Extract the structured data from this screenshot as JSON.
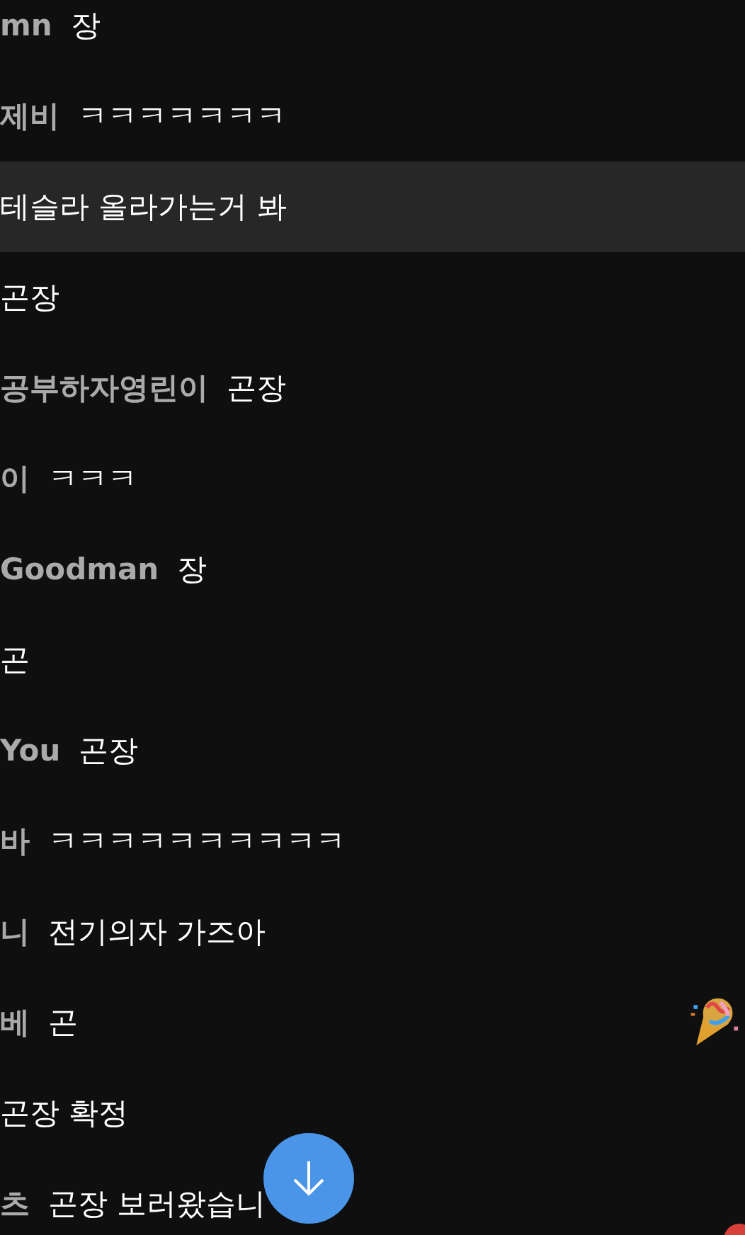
{
  "chat": {
    "messages": [
      {
        "author": "mn",
        "text": "장",
        "highlighted": false
      },
      {
        "author": "제비",
        "text": "ㅋㅋㅋㅋㅋㅋㅋ",
        "highlighted": false
      },
      {
        "text": "테슬라 올라가는거 봐",
        "highlighted": true
      },
      {
        "text": "곤장",
        "highlighted": false
      },
      {
        "author": "공부하자영린이",
        "text": "곤장",
        "highlighted": false
      },
      {
        "author": "이",
        "text": "ㅋㅋㅋ",
        "highlighted": false
      },
      {
        "author": "Goodman",
        "text": "장",
        "highlighted": false
      },
      {
        "text": "곤",
        "highlighted": false
      },
      {
        "author": "You",
        "text": "곤장",
        "highlighted": false
      },
      {
        "author": "바",
        "text": "ㅋㅋㅋㅋㅋㅋㅋㅋㅋㅋ",
        "highlighted": false
      },
      {
        "author": "니",
        "text": "전기의자 가즈아",
        "highlighted": false
      },
      {
        "author": "베",
        "text": "곤",
        "highlighted": false
      },
      {
        "text": "곤장 확정",
        "highlighted": false
      },
      {
        "author": "츠",
        "text": "곤장 보러왔습니",
        "highlighted": false
      }
    ]
  }
}
